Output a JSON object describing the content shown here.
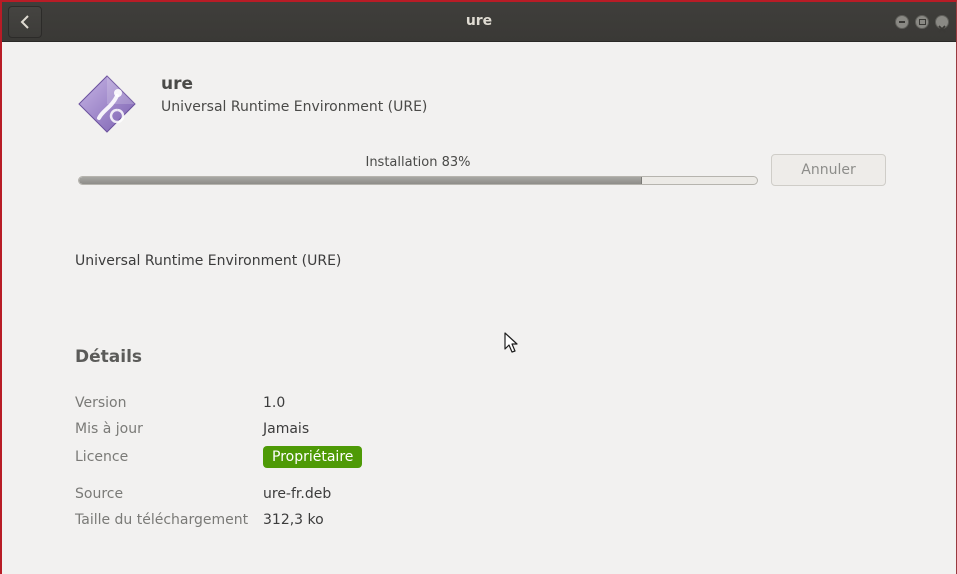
{
  "window": {
    "title": "ure"
  },
  "app": {
    "name": "ure",
    "summary": "Universal Runtime Environment (URE)",
    "icon": "package-diamond-icon",
    "description": "Universal Runtime Environment (URE)"
  },
  "install": {
    "label": "Installation 83%",
    "progress": 0.83,
    "cancel_label": "Annuler"
  },
  "details": {
    "heading": "Détails",
    "rows": [
      {
        "key": "Version",
        "value": "1.0"
      },
      {
        "key": "Mis à jour",
        "value": "Jamais"
      },
      {
        "key": "Licence",
        "value": "Propriétaire"
      },
      {
        "key": "Source",
        "value": "ure-fr.deb"
      },
      {
        "key": "Taille du téléchargement",
        "value": "312,3 ko"
      }
    ]
  },
  "colors": {
    "license_badge": "#4e9a06",
    "titlebar": "#3c3b37",
    "window_border": "#b81c26"
  }
}
